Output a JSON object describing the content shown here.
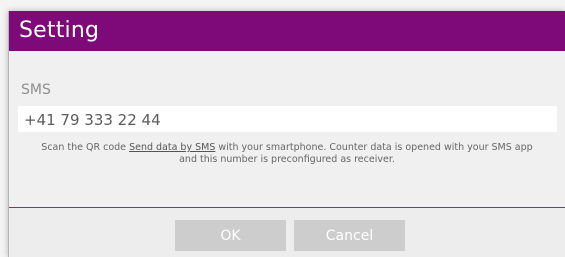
{
  "dialog": {
    "title": "Setting",
    "field_label": "SMS",
    "sms_number": "+41 79 333 22 44",
    "hint": {
      "before_link": "Scan the QR code ",
      "link_text": "Send data by SMS",
      "after_link": " with your smartphone. Counter data is opened with your SMS app and this number is preconfigured as receiver."
    },
    "buttons": {
      "ok_label": "OK",
      "cancel_label": "Cancel"
    }
  },
  "colors": {
    "title_bar": "#7d0a78",
    "divider": "#8a2f86",
    "button_bg": "#cdcdcd"
  }
}
